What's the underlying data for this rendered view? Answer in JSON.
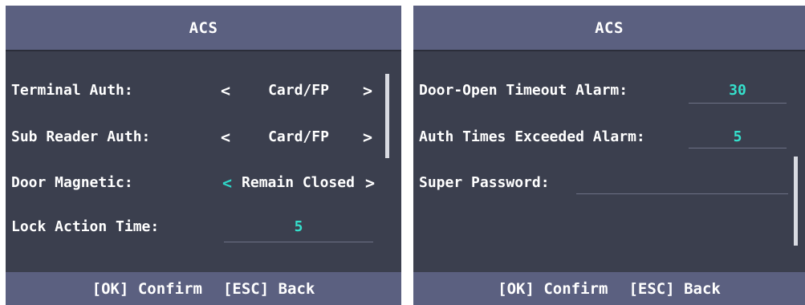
{
  "left_panel": {
    "title": "ACS",
    "rows": {
      "terminal_auth": {
        "label": "Terminal Auth:",
        "value": "Card/FP",
        "prev": "<",
        "next": ">"
      },
      "sub_reader_auth": {
        "label": "Sub Reader Auth:",
        "value": "Card/FP",
        "prev": "<",
        "next": ">"
      },
      "door_magnetic": {
        "label": "Door Magnetic:",
        "value": "Remain Closed",
        "prev": "<",
        "next": ">"
      },
      "lock_action_time": {
        "label": "Lock Action Time:",
        "value": "5"
      }
    },
    "footer": {
      "confirm": "[OK] Confirm",
      "back": "[ESC] Back"
    }
  },
  "right_panel": {
    "title": "ACS",
    "rows": {
      "door_open_timeout_alarm": {
        "label": "Door-Open Timeout Alarm:",
        "value": "30"
      },
      "auth_times_exceeded_alarm": {
        "label": "Auth Times Exceeded Alarm:",
        "value": "5"
      },
      "super_password": {
        "label": "Super Password:",
        "value": ""
      }
    },
    "footer": {
      "confirm": "[OK] Confirm",
      "back": "[ESC] Back"
    }
  },
  "colors": {
    "background": "#3b3f4e",
    "header": "#5b6080",
    "value_accent": "#35e0cc",
    "selected_arrow_accent": "#2fd6c8",
    "text": "#ffffff"
  }
}
